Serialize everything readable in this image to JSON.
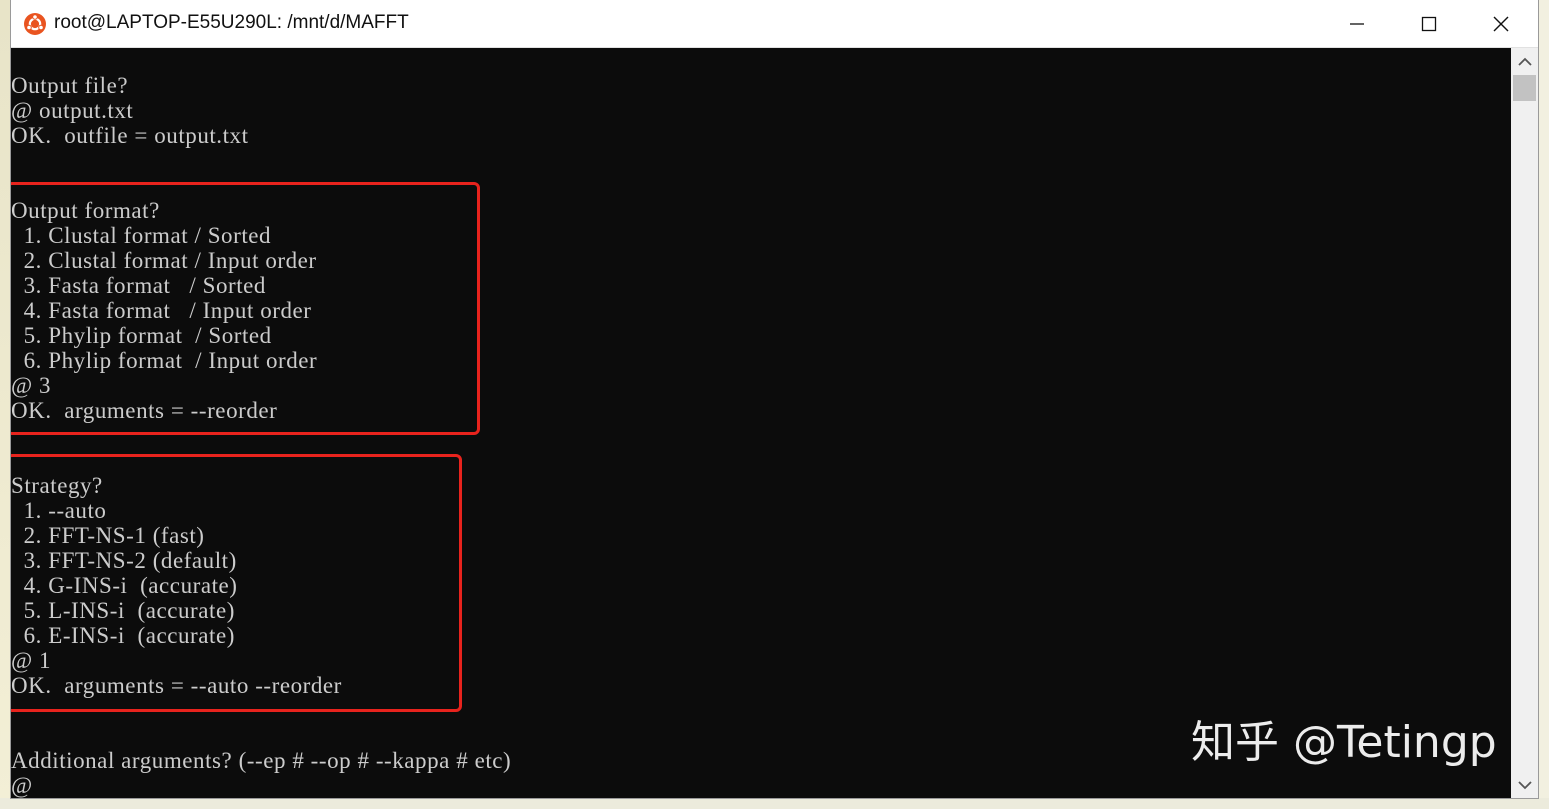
{
  "window": {
    "title": "root@LAPTOP-E55U290L: /mnt/d/MAFFT",
    "icon": "ubuntu-icon",
    "accent_color": "#e95420",
    "controls": {
      "minimize_icon": "minimize-icon",
      "maximize_icon": "maximize-icon",
      "close_icon": "close-icon"
    }
  },
  "console": {
    "lines": [
      "Output file?",
      "@ output.txt",
      "OK.  outfile = output.txt",
      "",
      "",
      "Output format?",
      "  1. Clustal format / Sorted",
      "  2. Clustal format / Input order",
      "  3. Fasta format   / Sorted",
      "  4. Fasta format   / Input order",
      "  5. Phylip format  / Sorted",
      "  6. Phylip format  / Input order",
      "@ 3",
      "OK.  arguments = --reorder",
      "",
      "",
      "Strategy?",
      "  1. --auto",
      "  2. FFT-NS-1 (fast)",
      "  3. FFT-NS-2 (default)",
      "  4. G-INS-i  (accurate)",
      "  5. L-INS-i  (accurate)",
      "  6. E-INS-i  (accurate)",
      "@ 1",
      "OK.  arguments = --auto --reorder",
      "",
      "",
      "Additional arguments? (--ep # --op # --kappa # etc)",
      "@"
    ],
    "text_color": "#cccccc",
    "background_color": "#0c0c0c"
  },
  "annotations": {
    "highlight_color": "#e8231d"
  },
  "watermark": {
    "text": "知乎 @Tetingp"
  },
  "scrollbar": {
    "up_icon": "scroll-up-arrow-icon",
    "down_icon": "scroll-down-arrow-icon"
  }
}
